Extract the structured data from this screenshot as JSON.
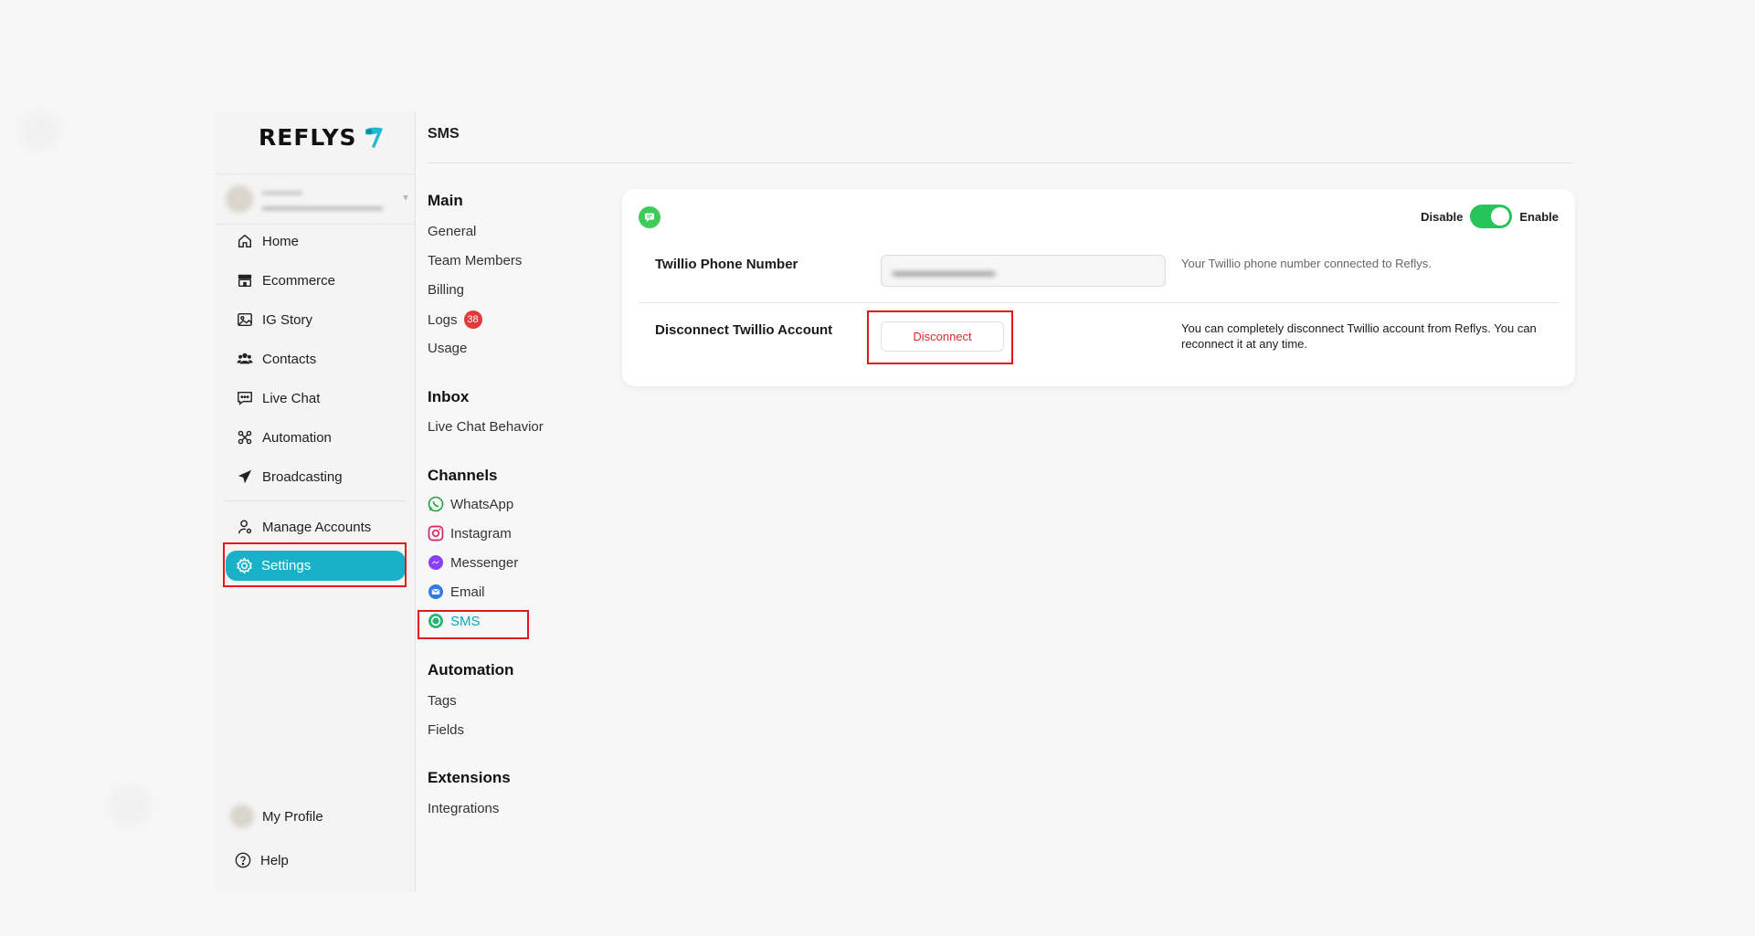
{
  "brand": {
    "logo_text": "REFLYS",
    "accent": "#18b1c8"
  },
  "sidebar": {
    "items": [
      {
        "label": "Home",
        "icon": "home-icon"
      },
      {
        "label": "Ecommerce",
        "icon": "store-icon"
      },
      {
        "label": "IG Story",
        "icon": "image-icon"
      },
      {
        "label": "Contacts",
        "icon": "users-icon"
      },
      {
        "label": "Live Chat",
        "icon": "chat-icon"
      },
      {
        "label": "Automation",
        "icon": "automation-icon"
      },
      {
        "label": "Broadcasting",
        "icon": "send-icon"
      }
    ],
    "manage_accounts": "Manage Accounts",
    "settings": "Settings",
    "my_profile": "My Profile",
    "help": "Help"
  },
  "submenu": {
    "title": "SMS",
    "sections": {
      "main": {
        "heading": "Main",
        "items": [
          "General",
          "Team Members",
          "Billing",
          "Logs",
          "Usage"
        ],
        "logs_badge": "38"
      },
      "inbox": {
        "heading": "Inbox",
        "items": [
          "Live Chat Behavior"
        ]
      },
      "channels": {
        "heading": "Channels",
        "items": [
          "WhatsApp",
          "Instagram",
          "Messenger",
          "Email",
          "SMS"
        ]
      },
      "automation": {
        "heading": "Automation",
        "items": [
          "Tags",
          "Fields"
        ]
      },
      "extensions": {
        "heading": "Extensions",
        "items": [
          "Integrations"
        ]
      }
    }
  },
  "card": {
    "toggle": {
      "off_label": "Disable",
      "on_label": "Enable",
      "state": "on"
    },
    "phone": {
      "label": "Twillio Phone Number",
      "help": "Your Twillio phone number connected to Reflys."
    },
    "disconnect": {
      "label": "Disconnect Twillio Account",
      "button": "Disconnect",
      "help": "You can completely disconnect Twillio account from Reflys. You can reconnect it at any time."
    }
  }
}
